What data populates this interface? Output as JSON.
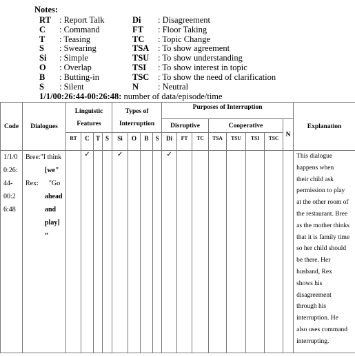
{
  "notes": {
    "title": "Notes:",
    "left": [
      {
        "abbr": "RT",
        "desc": ": Report Talk"
      },
      {
        "abbr": "C",
        "desc": ": Command"
      },
      {
        "abbr": "T",
        "desc": ": Teasing"
      },
      {
        "abbr": "S",
        "desc": ": Swearing"
      },
      {
        "abbr": "Si",
        "desc": ": Simple"
      },
      {
        "abbr": "O",
        "desc": ": Overlap"
      },
      {
        "abbr": "B",
        "desc": ": Butting-in"
      },
      {
        "abbr": "S",
        "desc": ": Silent"
      }
    ],
    "right": [
      {
        "abbr": "Di",
        "desc": ": Disagreement"
      },
      {
        "abbr": "FT",
        "desc": ": Floor Taking"
      },
      {
        "abbr": "TC",
        "desc": ": Topic Change"
      },
      {
        "abbr": "TSA",
        "desc": ": To show agreement"
      },
      {
        "abbr": "TSU",
        "desc": ": To show understanding"
      },
      {
        "abbr": "TSI",
        "desc": ": To show interest in topic"
      },
      {
        "abbr": "TSC",
        "desc": ": To show the need of clarification"
      },
      {
        "abbr": "N",
        "desc": ": Neutral"
      }
    ],
    "format_key": "1/1/00:26:44-00:26:48:",
    "format_desc": " number of data/episode/time"
  },
  "table": {
    "headers": {
      "code": "Code",
      "dialogues": "Dialogues",
      "linguistic_1": "Linguistic",
      "linguistic_2": "Features",
      "types_1": "Types of",
      "types_2": "Interruption",
      "purposes": "Purposes of Interruption",
      "disruptive": "Disruptive",
      "cooperative": "Cooperative",
      "n": "N",
      "explanation": "Explanation",
      "sub": [
        "RT",
        "C",
        "T",
        "S",
        "Si",
        "O",
        "B",
        "S",
        "Di",
        "FT",
        "TC",
        "TSA",
        "TSU",
        "TSI",
        "TSC"
      ]
    },
    "row": {
      "code_lines": [
        "1/1/0",
        "0:26:",
        "44-",
        "00:2",
        "6:48"
      ],
      "dialogue_lines": [
        "Bree:\"I think",
        "[we\"",
        "Rex:      \"Go",
        "ahead",
        "and",
        "play]",
        "”"
      ],
      "checks": [
        false,
        true,
        false,
        false,
        true,
        false,
        false,
        false,
        true,
        false,
        false,
        false,
        false,
        false,
        false,
        false
      ],
      "check_mark": "✓",
      "explanation_lines": [
        "This dialogue",
        "happens  when",
        "their child ask",
        "permission to play",
        "at the other room of",
        "the restaurant. Bree",
        "as the mother thinks",
        "that it is family time",
        "so her child should",
        "be there. Her",
        "husband, Rex",
        "shows his",
        "disagreement",
        "through his",
        "interruption. He",
        "also uses command",
        "interrupting."
      ]
    }
  }
}
